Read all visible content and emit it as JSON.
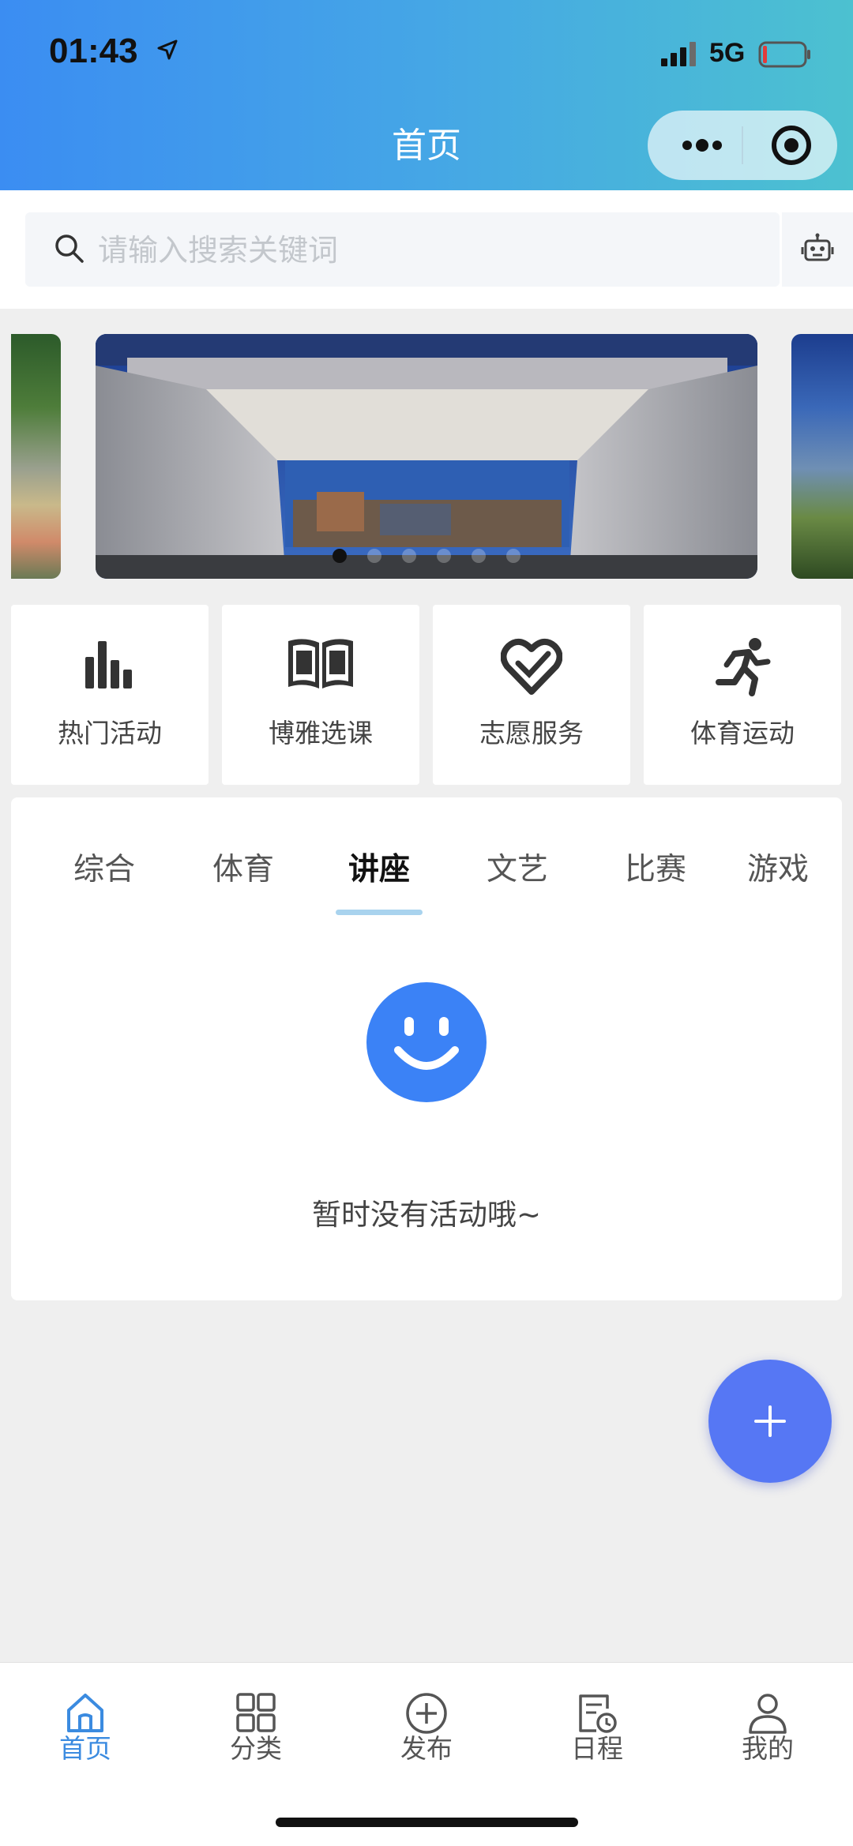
{
  "status_bar": {
    "time": "01:43",
    "network": "5G"
  },
  "header": {
    "title": "首页"
  },
  "search": {
    "placeholder": "请输入搜索关键词"
  },
  "banner": {
    "slide_count": 6,
    "active_index": 0
  },
  "quick_entries": [
    {
      "label": "热门活动",
      "icon": "bar-chart-icon"
    },
    {
      "label": "博雅选课",
      "icon": "book-icon"
    },
    {
      "label": "志愿服务",
      "icon": "heart-hand-icon"
    },
    {
      "label": "体育运动",
      "icon": "running-icon"
    }
  ],
  "tabs": {
    "items": [
      "综合",
      "体育",
      "讲座",
      "文艺",
      "比赛",
      "游戏"
    ],
    "active": "讲座"
  },
  "empty_state": {
    "text": "暂时没有活动哦~"
  },
  "fab": {
    "label": "+"
  },
  "bottom_nav": {
    "items": [
      {
        "label": "首页",
        "icon": "home-icon"
      },
      {
        "label": "分类",
        "icon": "grid-icon"
      },
      {
        "label": "发布",
        "icon": "plus-circle-icon"
      },
      {
        "label": "日程",
        "icon": "schedule-icon"
      },
      {
        "label": "我的",
        "icon": "user-icon"
      }
    ],
    "active": "首页"
  },
  "colors": {
    "accent": "#3b8be0",
    "fab": "#5677f4",
    "empty_icon": "#3b82f6",
    "header_gradient": [
      "#3b8df2",
      "#4cc1d0"
    ]
  }
}
